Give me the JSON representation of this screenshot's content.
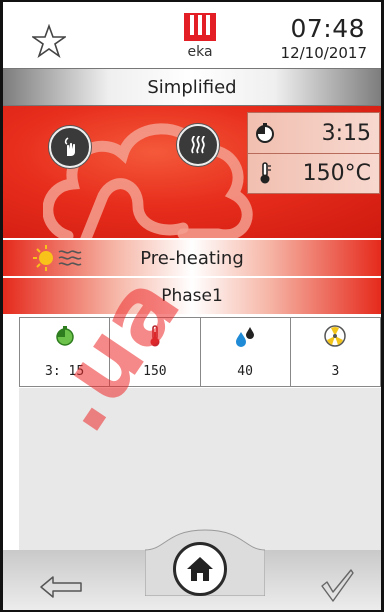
{
  "header": {
    "time": "07:48",
    "date": "12/10/2017",
    "logo_text": "eka"
  },
  "mode": {
    "label": "Simplified"
  },
  "cooking": {
    "timer_value": "3:15",
    "temperature_value": "150°C"
  },
  "status": {
    "label": "Pre-heating"
  },
  "phase": {
    "label": "Phase1"
  },
  "params": [
    {
      "icon": "timer-icon",
      "value": "3: 15"
    },
    {
      "icon": "thermometer-icon",
      "value": "150"
    },
    {
      "icon": "humidity-drops-icon",
      "value": "40"
    },
    {
      "icon": "fan-icon",
      "value": "3"
    }
  ],
  "watermark": ".ua",
  "colors": {
    "accent_red": "#e52a1c",
    "panel_info": "#f4cabd"
  }
}
